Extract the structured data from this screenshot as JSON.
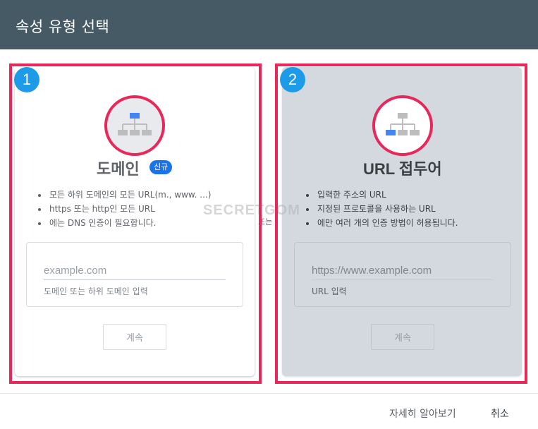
{
  "dialog": {
    "title": "속성 유형 선택"
  },
  "domain_card": {
    "number": "1",
    "icon": "sitemap-icon",
    "title": "도메인",
    "new_badge": "신규",
    "bullets": [
      "모든 하위 도메인의 모든 URL(m., www. ...)",
      "https 또는 http인 모든 URL",
      "에는 DNS 인증이 필요합니다."
    ],
    "input_placeholder": "example.com",
    "input_helper": "도메인 또는 하위 도메인 입력",
    "continue_label": "계속"
  },
  "or_text": "또는",
  "prefix_card": {
    "number": "2",
    "icon": "sitemap-icon",
    "title": "URL 접두어",
    "bullets": [
      "입력한 주소의 URL",
      "지정된 프로토콜을 사용하는 URL",
      "에만 여러 개의 인증 방법이 허용됩니다."
    ],
    "input_placeholder": "https://www.example.com",
    "input_helper": "URL 입력",
    "continue_label": "계속"
  },
  "watermark": "SECRETGOM",
  "footer": {
    "learn_more": "자세히 알아보기",
    "cancel": "취소"
  },
  "colors": {
    "header": "#455a64",
    "highlight": "#e8285a",
    "badge": "#1e9be8",
    "accent_blue": "#4285f4",
    "node_gray": "#bdbdbd"
  }
}
